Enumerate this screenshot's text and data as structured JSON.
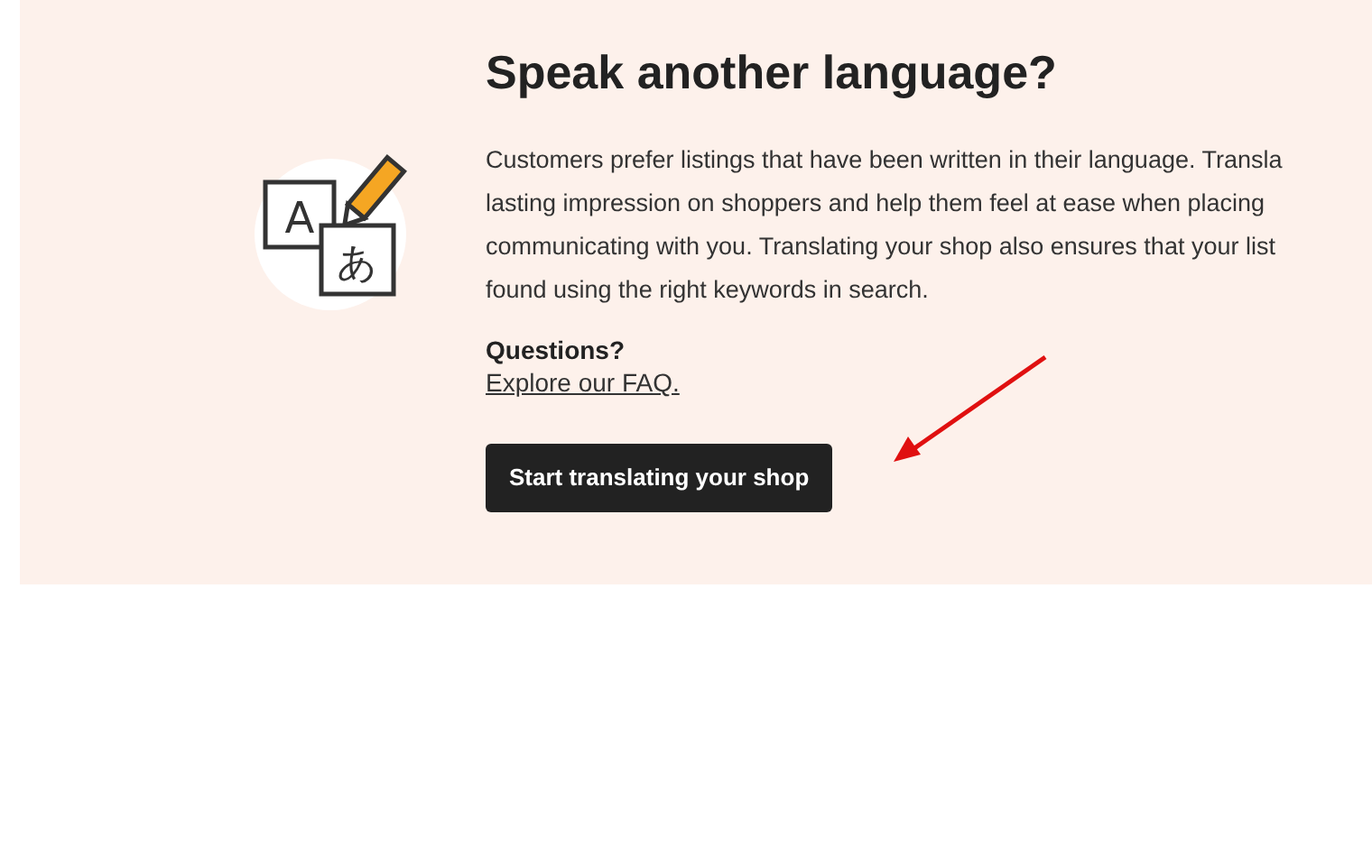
{
  "icon_glyphs": [
    "A",
    "あ"
  ],
  "title": "Speak another language?",
  "paragraph_lines": [
    "Customers prefer listings that have been written in their language. Transla",
    "lasting impression on shoppers and help them feel at ease when placing",
    "communicating with you. Translating your shop also ensures that your list",
    "found using the right keywords in search."
  ],
  "questions_label": "Questions?",
  "faq_link": "Explore our FAQ.",
  "button": "Start translating your shop"
}
